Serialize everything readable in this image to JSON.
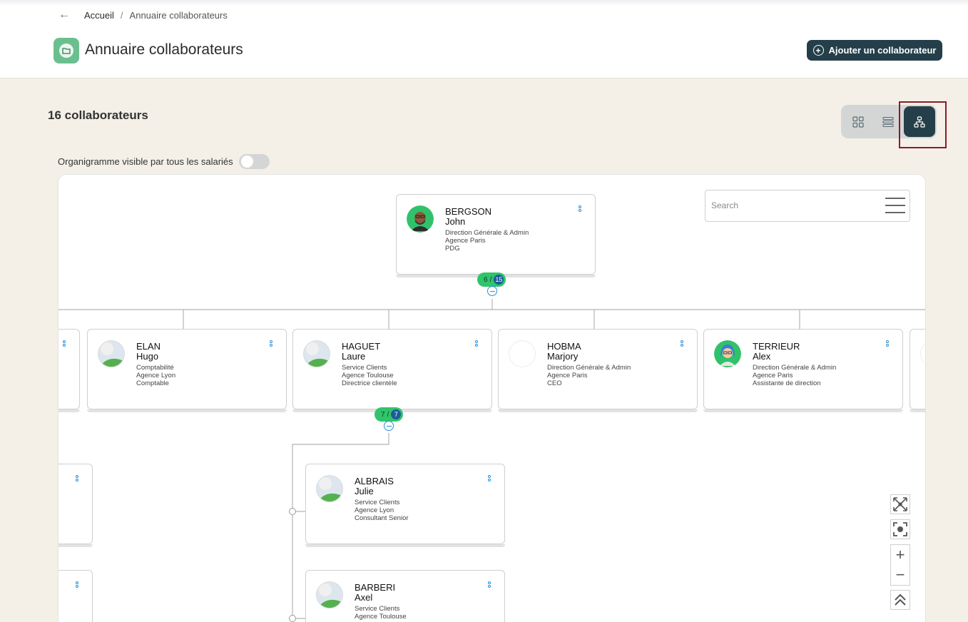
{
  "breadcrumb": {
    "home": "Accueil",
    "separator": "/",
    "current": "Annuaire collaborateurs"
  },
  "header": {
    "title": "Annuaire collaborateurs",
    "add_button": "Ajouter un collaborateur"
  },
  "summary": {
    "count": "16 collaborateurs"
  },
  "view_modes": {
    "options": [
      "grid",
      "list",
      "org-chart"
    ],
    "active": "org-chart"
  },
  "visibility_toggle": {
    "label": "Organigramme visible par tous les salariés",
    "on": false
  },
  "search": {
    "placeholder": "Search"
  },
  "root": {
    "last": "BERGSON",
    "first": "John",
    "dept": "Direction Générale & Admin",
    "agency": "Agence Paris",
    "role": "PDG",
    "pill": {
      "shown": "6",
      "sep": "/",
      "total": "15"
    }
  },
  "level1": [
    {
      "last": "ELAN",
      "first": "Hugo",
      "dept": "Comptabilité",
      "agency": "Agence Lyon",
      "role": "Comptable"
    },
    {
      "last": "HAGUET",
      "first": "Laure",
      "dept": "Service Clients",
      "agency": "Agence Toulouse",
      "role": "Directrice clientèle",
      "pill": {
        "shown": "7",
        "sep": "/",
        "total": "7"
      }
    },
    {
      "last": "HOBMA",
      "first": "Marjory",
      "dept": "Direction Générale & Admin",
      "agency": "Agence Paris",
      "role": "CEO"
    },
    {
      "last": "TERRIEUR",
      "first": "Alex",
      "dept": "Direction Générale & Admin",
      "agency": "Agence Paris",
      "role": "Assistante de direction"
    }
  ],
  "level2": [
    {
      "last": "ALBRAIS",
      "first": "Julie",
      "dept": "Service Clients",
      "agency": "Agence Lyon",
      "role": "Consultant Senior"
    },
    {
      "last": "BARBERI",
      "first": "Axel",
      "dept": "Service Clients",
      "agency": "Agence Toulouse",
      "role": ""
    }
  ],
  "colors": {
    "primary": "#253f4a",
    "accent_green": "#30c46b",
    "count_blue": "#1c5c99",
    "link_blue": "#2a8fd6",
    "highlight": "#8a1b28"
  }
}
